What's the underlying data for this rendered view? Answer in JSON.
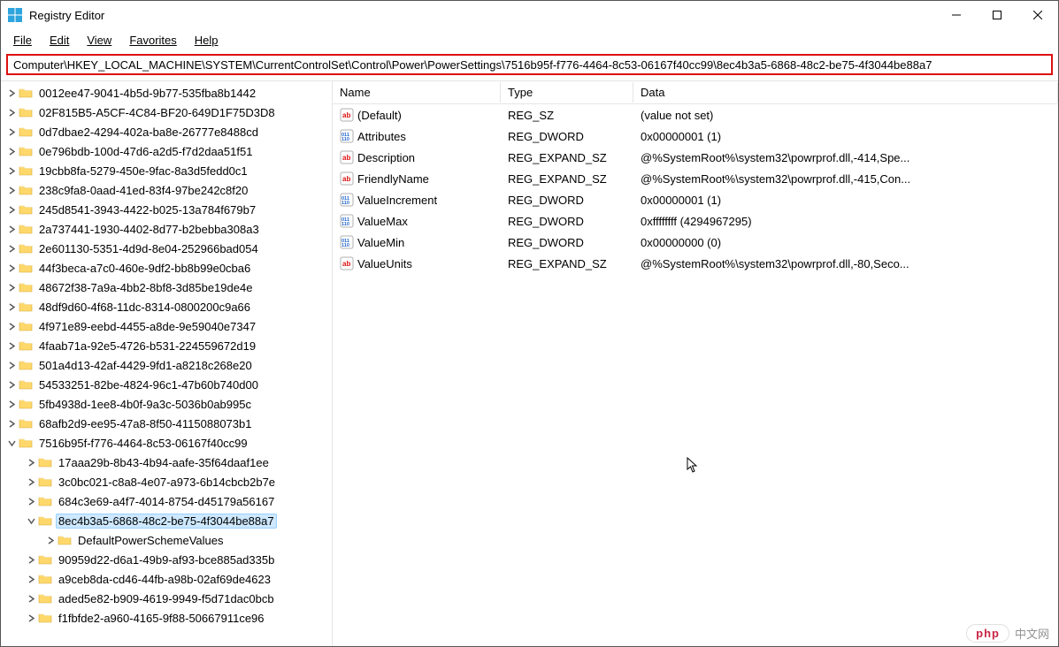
{
  "window": {
    "title": "Registry Editor"
  },
  "menu": {
    "file": "File",
    "edit": "Edit",
    "view": "View",
    "favorites": "Favorites",
    "help": "Help"
  },
  "address": "Computer\\HKEY_LOCAL_MACHINE\\SYSTEM\\CurrentControlSet\\Control\\Power\\PowerSettings\\7516b95f-f776-4464-8c53-06167f40cc99\\8ec4b3a5-6868-48c2-be75-4f3044be88a7",
  "listHeader": {
    "name": "Name",
    "type": "Type",
    "data": "Data"
  },
  "values": [
    {
      "name": "(Default)",
      "type": "REG_SZ",
      "data": "(value not set)",
      "icon": "sz"
    },
    {
      "name": "Attributes",
      "type": "REG_DWORD",
      "data": "0x00000001 (1)",
      "icon": "bin"
    },
    {
      "name": "Description",
      "type": "REG_EXPAND_SZ",
      "data": "@%SystemRoot%\\system32\\powrprof.dll,-414,Spe...",
      "icon": "sz"
    },
    {
      "name": "FriendlyName",
      "type": "REG_EXPAND_SZ",
      "data": "@%SystemRoot%\\system32\\powrprof.dll,-415,Con...",
      "icon": "sz"
    },
    {
      "name": "ValueIncrement",
      "type": "REG_DWORD",
      "data": "0x00000001 (1)",
      "icon": "bin"
    },
    {
      "name": "ValueMax",
      "type": "REG_DWORD",
      "data": "0xffffffff (4294967295)",
      "icon": "bin"
    },
    {
      "name": "ValueMin",
      "type": "REG_DWORD",
      "data": "0x00000000 (0)",
      "icon": "bin"
    },
    {
      "name": "ValueUnits",
      "type": "REG_EXPAND_SZ",
      "data": "@%SystemRoot%\\system32\\powrprof.dll,-80,Seco...",
      "icon": "sz"
    }
  ],
  "tree": [
    {
      "depth": 0,
      "exp": "closed",
      "label": "0012ee47-9041-4b5d-9b77-535fba8b1442"
    },
    {
      "depth": 0,
      "exp": "closed",
      "label": "02F815B5-A5CF-4C84-BF20-649D1F75D3D8"
    },
    {
      "depth": 0,
      "exp": "closed",
      "label": "0d7dbae2-4294-402a-ba8e-26777e8488cd"
    },
    {
      "depth": 0,
      "exp": "closed",
      "label": "0e796bdb-100d-47d6-a2d5-f7d2daa51f51"
    },
    {
      "depth": 0,
      "exp": "closed",
      "label": "19cbb8fa-5279-450e-9fac-8a3d5fedd0c1"
    },
    {
      "depth": 0,
      "exp": "closed",
      "label": "238c9fa8-0aad-41ed-83f4-97be242c8f20"
    },
    {
      "depth": 0,
      "exp": "closed",
      "label": "245d8541-3943-4422-b025-13a784f679b7"
    },
    {
      "depth": 0,
      "exp": "closed",
      "label": "2a737441-1930-4402-8d77-b2bebba308a3"
    },
    {
      "depth": 0,
      "exp": "closed",
      "label": "2e601130-5351-4d9d-8e04-252966bad054"
    },
    {
      "depth": 0,
      "exp": "closed",
      "label": "44f3beca-a7c0-460e-9df2-bb8b99e0cba6"
    },
    {
      "depth": 0,
      "exp": "closed",
      "label": "48672f38-7a9a-4bb2-8bf8-3d85be19de4e"
    },
    {
      "depth": 0,
      "exp": "closed",
      "label": "48df9d60-4f68-11dc-8314-0800200c9a66"
    },
    {
      "depth": 0,
      "exp": "closed",
      "label": "4f971e89-eebd-4455-a8de-9e59040e7347"
    },
    {
      "depth": 0,
      "exp": "closed",
      "label": "4faab71a-92e5-4726-b531-224559672d19"
    },
    {
      "depth": 0,
      "exp": "closed",
      "label": "501a4d13-42af-4429-9fd1-a8218c268e20"
    },
    {
      "depth": 0,
      "exp": "closed",
      "label": "54533251-82be-4824-96c1-47b60b740d00"
    },
    {
      "depth": 0,
      "exp": "closed",
      "label": "5fb4938d-1ee8-4b0f-9a3c-5036b0ab995c"
    },
    {
      "depth": 0,
      "exp": "closed",
      "label": "68afb2d9-ee95-47a8-8f50-4115088073b1"
    },
    {
      "depth": 0,
      "exp": "open",
      "label": "7516b95f-f776-4464-8c53-06167f40cc99"
    },
    {
      "depth": 1,
      "exp": "closed",
      "label": "17aaa29b-8b43-4b94-aafe-35f64daaf1ee"
    },
    {
      "depth": 1,
      "exp": "closed",
      "label": "3c0bc021-c8a8-4e07-a973-6b14cbcb2b7e"
    },
    {
      "depth": 1,
      "exp": "closed",
      "label": "684c3e69-a4f7-4014-8754-d45179a56167"
    },
    {
      "depth": 1,
      "exp": "open",
      "label": "8ec4b3a5-6868-48c2-be75-4f3044be88a7",
      "selected": true
    },
    {
      "depth": 2,
      "exp": "closed",
      "label": "DefaultPowerSchemeValues"
    },
    {
      "depth": 1,
      "exp": "closed",
      "label": "90959d22-d6a1-49b9-af93-bce885ad335b"
    },
    {
      "depth": 1,
      "exp": "closed",
      "label": "a9ceb8da-cd46-44fb-a98b-02af69de4623"
    },
    {
      "depth": 1,
      "exp": "closed",
      "label": "aded5e82-b909-4619-9949-f5d71dac0bcb"
    },
    {
      "depth": 1,
      "exp": "closed",
      "label": "f1fbfde2-a960-4165-9f88-50667911ce96"
    }
  ],
  "watermark": {
    "brand": "php",
    "text": "中文网"
  }
}
